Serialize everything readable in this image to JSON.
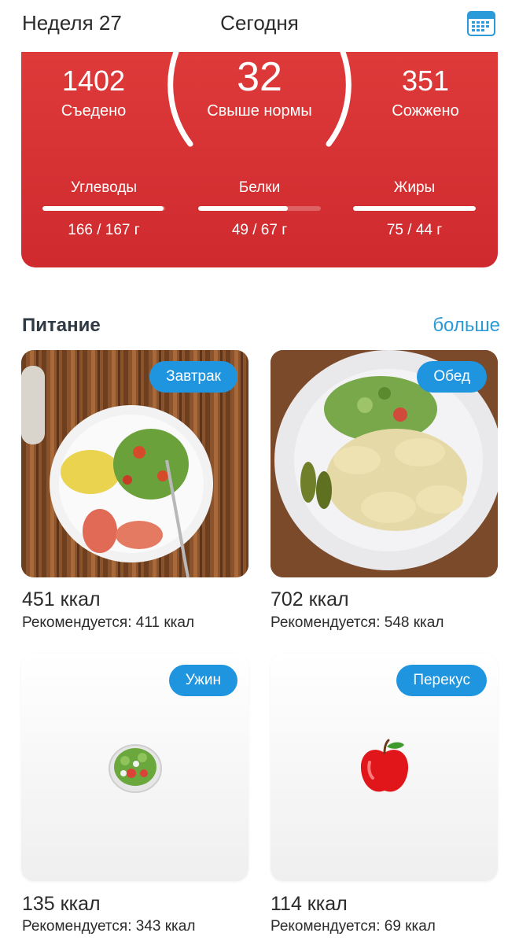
{
  "header": {
    "week_label": "Неделя 27",
    "title": "Сегодня",
    "calendar_icon": "calendar-icon"
  },
  "summary": {
    "eaten": {
      "value": "1402",
      "label": "Съедено"
    },
    "over": {
      "value": "32",
      "label": "Свыше нормы"
    },
    "burned": {
      "value": "351",
      "label": "Сожжено"
    },
    "background_color": "#d83236",
    "macros": [
      {
        "label": "Углеводы",
        "value": "166 / 167 г",
        "progress": 0.99
      },
      {
        "label": "Белки",
        "value": "49 / 67 г",
        "progress": 0.73
      },
      {
        "label": "Жиры",
        "value": "75 / 44 г",
        "progress": 1.0
      }
    ]
  },
  "nutrition": {
    "title": "Питание",
    "more_link": "больше",
    "accent_color": "#1f95e0",
    "meals": [
      {
        "tag": "Завтрак",
        "kcal": "451 ккал",
        "recommended": "Рекомендуется: 411 ккал",
        "image": "breakfast-photo"
      },
      {
        "tag": "Обед",
        "kcal": "702 ккал",
        "recommended": "Рекомендуется: 548 ккал",
        "image": "lunch-photo"
      },
      {
        "tag": "Ужин",
        "kcal": "135 ккал",
        "recommended": "Рекомендуется: 343 ккал",
        "image": "salad-icon"
      },
      {
        "tag": "Перекус",
        "kcal": "114 ккал",
        "recommended": "Рекомендуется: 69 ккал",
        "image": "apple-icon"
      }
    ]
  }
}
